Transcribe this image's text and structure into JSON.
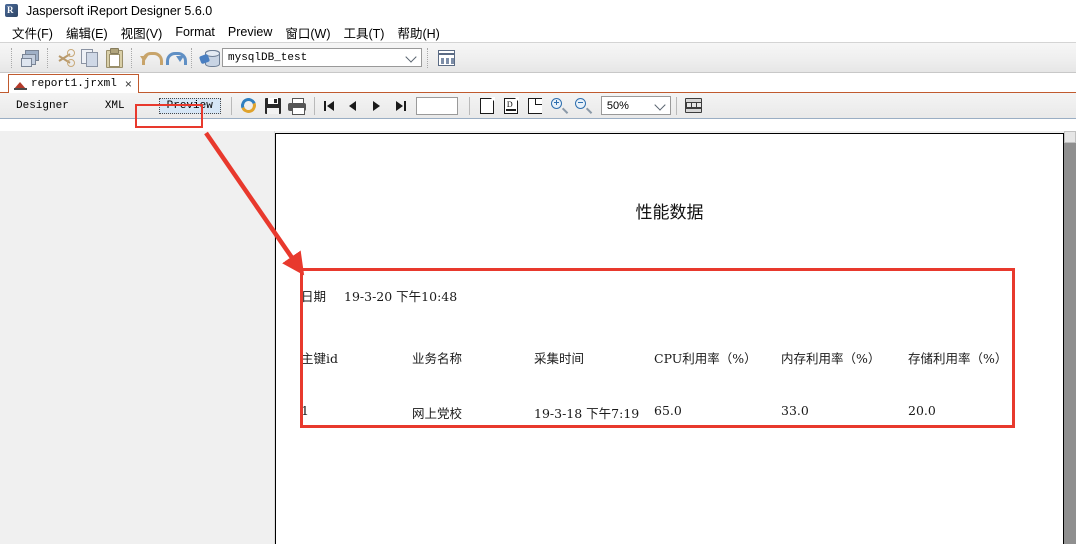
{
  "window": {
    "title": "Jaspersoft iReport Designer 5.6.0",
    "app_icon": "ireport-icon"
  },
  "menubar": {
    "items": [
      {
        "label": "文件(F)",
        "name": "menu-file"
      },
      {
        "label": "编辑(E)",
        "name": "menu-edit"
      },
      {
        "label": "视图(V)",
        "name": "menu-view"
      },
      {
        "label": "Format",
        "name": "menu-format"
      },
      {
        "label": "Preview",
        "name": "menu-preview"
      },
      {
        "label": "窗口(W)",
        "name": "menu-window"
      },
      {
        "label": "工具(T)",
        "name": "menu-tools"
      },
      {
        "label": "帮助(H)",
        "name": "menu-help"
      }
    ]
  },
  "toolbar": {
    "icons": [
      "new-report-icon",
      "cut-icon",
      "copy-icon",
      "paste-icon",
      "undo-icon",
      "redo-icon",
      "datasource-icon"
    ],
    "datasource": {
      "value": "mysqlDB_test",
      "placeholder": "mysqlDB_test"
    },
    "report_query_icon": "report-query-icon"
  },
  "document_tab": {
    "label": "report1.jrxml",
    "close": "×",
    "icon": "jrxml-file-icon"
  },
  "view_tabs": [
    {
      "label": "Designer",
      "name": "tab-designer",
      "active": false
    },
    {
      "label": "XML",
      "name": "tab-xml",
      "active": false
    },
    {
      "label": "Preview",
      "name": "tab-preview",
      "active": true
    }
  ],
  "view_toolbar": {
    "refresh_icon": "refresh-icon",
    "save_icon": "save-icon",
    "print_icon": "print-icon",
    "first_page_icon": "first-page-icon",
    "prev_page_icon": "previous-page-icon",
    "next_page_icon": "next-page-icon",
    "last_page_icon": "last-page-icon",
    "page_number": "",
    "page_number_placeholder": "",
    "actual_size_icon": "actual-size-icon",
    "fit_width_icon": "fit-page-width-icon",
    "fit_page_icon": "fit-whole-page-icon",
    "zoom_in_icon": "zoom-in-icon",
    "zoom_out_icon": "zoom-out-icon",
    "zoom_value": "50%",
    "export_icon": "export-icon"
  },
  "report": {
    "title": "性能数据",
    "date_label": "日期",
    "date_value": "19-3-20 下午10:48",
    "columns": [
      "主键id",
      "业务名称",
      "采集时间",
      "CPU利用率（%）",
      "内存利用率（%）",
      "存储利用率（%）"
    ],
    "rows": [
      {
        "id": "1",
        "business": "网上党校",
        "collect_time": "19-3-18 下午7:19",
        "cpu": "65.0",
        "memory": "33.0",
        "storage": "20.0"
      }
    ]
  },
  "annotations": {
    "highlight_color": "#e8392d",
    "preview_box_name": "preview-tab-highlight",
    "result_box_name": "report-detail-highlight",
    "arrow_name": "annotation-arrow"
  }
}
